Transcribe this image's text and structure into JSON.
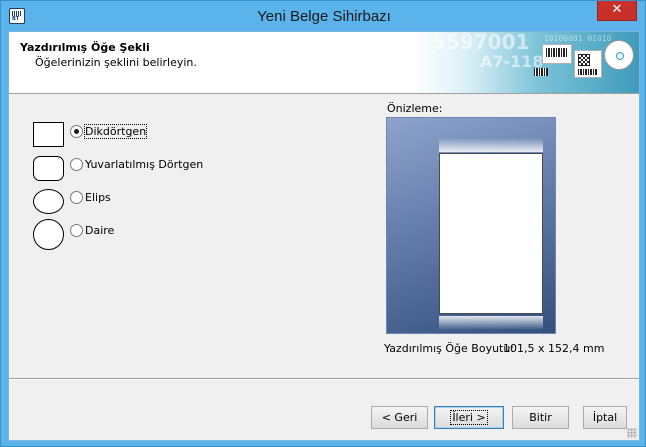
{
  "window": {
    "title": "Yeni Belge Sihirbazı",
    "app_icon_text": "BT",
    "close_glyph": "✕"
  },
  "header": {
    "title": "Yazdırılmış Öğe Şekli",
    "subtitle": "Öğelerinizin şeklini belirleyin.",
    "banner_text_1": "5597001",
    "banner_text_2": "A7-118",
    "banner_digits": "10100001 01010"
  },
  "shapes": {
    "options": [
      {
        "id": "rectangle",
        "label": "Dikdörtgen",
        "checked": true,
        "icon": "rectangle-shape-icon"
      },
      {
        "id": "rounded",
        "label": "Yuvarlatılmış Dörtgen",
        "checked": false,
        "icon": "rounded-rectangle-shape-icon"
      },
      {
        "id": "ellipse",
        "label": "Elips",
        "checked": false,
        "icon": "ellipse-shape-icon"
      },
      {
        "id": "circle",
        "label": "Daire",
        "checked": false,
        "icon": "circle-shape-icon"
      }
    ]
  },
  "preview": {
    "label": "Önizleme:",
    "size_label": "Yazdırılmış Öğe Boyutu:",
    "size_value": "101,5 x 152,4 mm"
  },
  "buttons": {
    "back": "< Geri",
    "next": "İleri >",
    "finish": "Bitir",
    "cancel": "İptal"
  },
  "colors": {
    "titlebar": "#5ab3ea",
    "close": "#c7312a",
    "preview_bg_top": "#8ea4cc",
    "preview_bg_bottom": "#34507f"
  }
}
